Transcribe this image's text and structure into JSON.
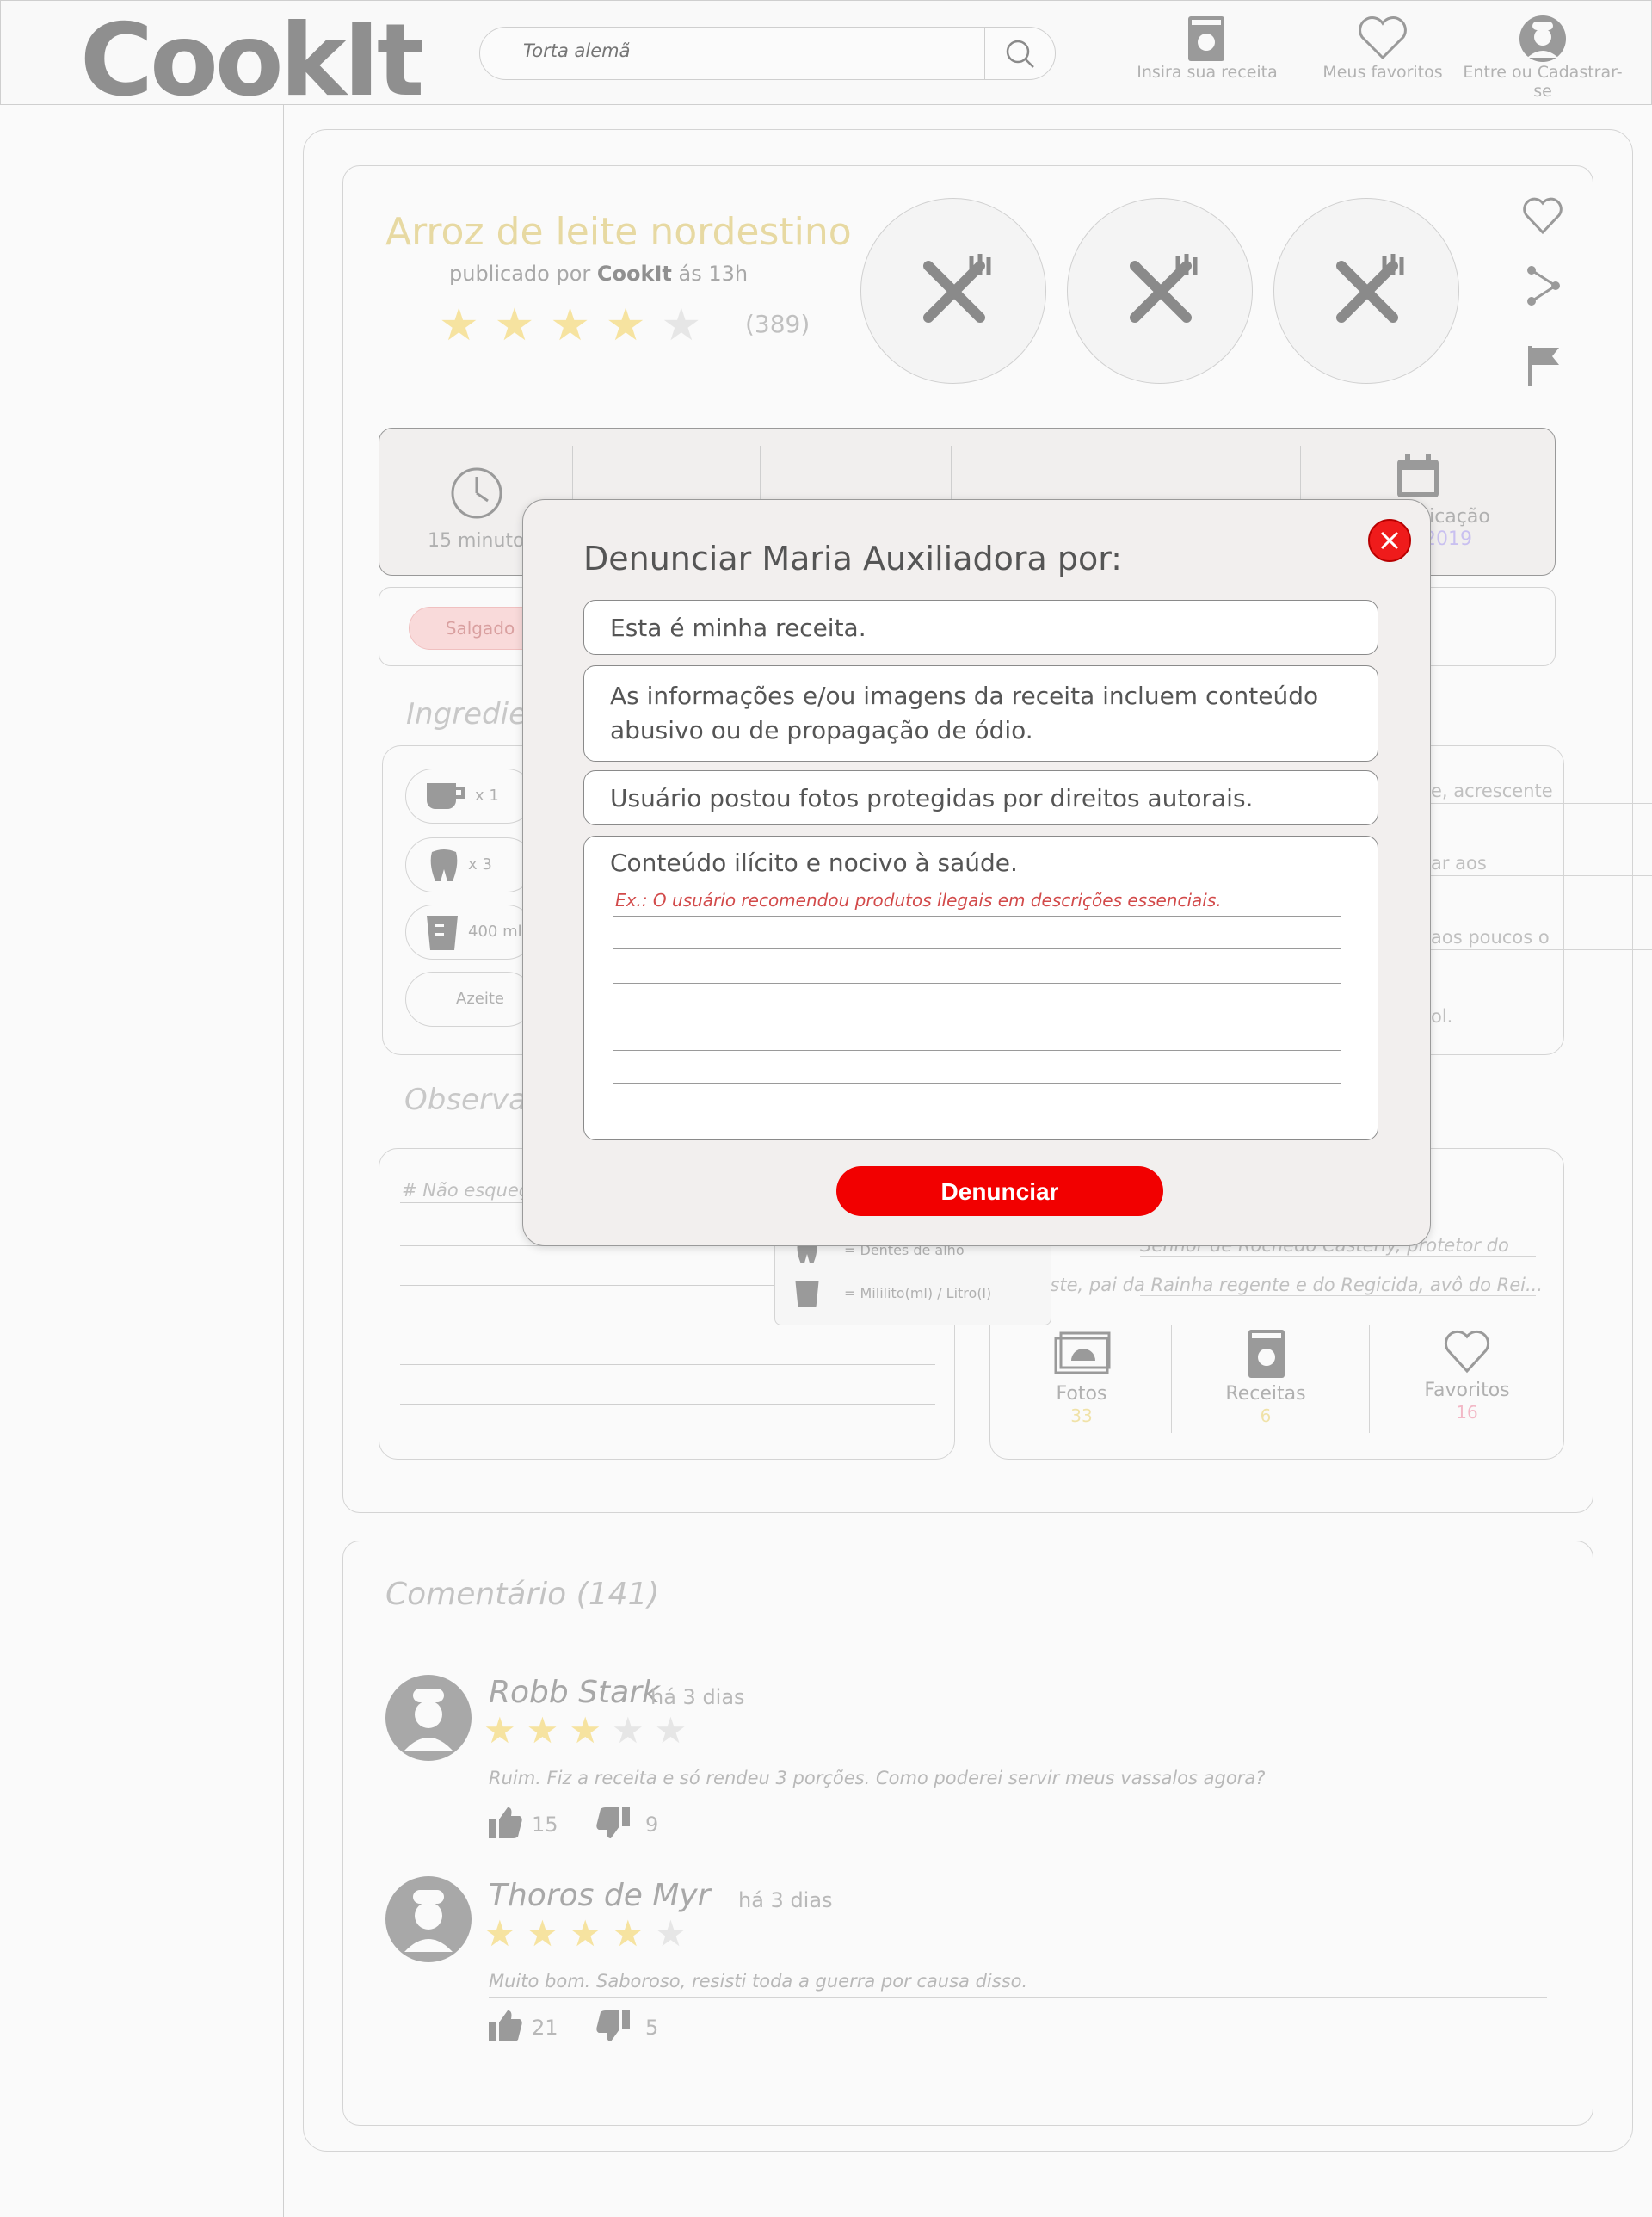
{
  "header": {
    "logo": "CookIt",
    "search_placeholder": "Torta alemã",
    "nav": [
      {
        "label": "Insira sua receita",
        "icon": "recipe-book-icon"
      },
      {
        "label": "Meus favoritos",
        "icon": "heart-icon"
      },
      {
        "label": "Entre ou Cadastrar-se",
        "icon": "chef-avatar-icon"
      }
    ]
  },
  "recipe": {
    "title": "Arroz de leite nordestino",
    "published_prefix": "publicado por",
    "author": "CookIt",
    "published_suffix": "ás 13h",
    "rating": 4,
    "rating_count": "(389)",
    "info": {
      "time": "15 minutos",
      "publish_label": "blicação",
      "publish_date": "2019"
    },
    "tag": "Salgado",
    "ingredients_heading": "Ingredier",
    "ingredients": [
      {
        "qty": "x 1",
        "icon": "cup-icon"
      },
      {
        "qty": "x 3",
        "icon": "garlic-tooth-icon"
      },
      {
        "qty": "400 ml",
        "icon": "measuring-cup-icon"
      },
      {
        "qty": "Azeite",
        "icon": ""
      }
    ],
    "prep_fragments": [
      "e, acrescente",
      "ar aos",
      "aos poucos o",
      "ol."
    ],
    "observations_heading": "Observaç",
    "observation_placeholder": "# Não esqueç",
    "legend": [
      "= Dentes de alho",
      "= Mililito(ml) / Litro(l)"
    ],
    "author_bio": [
      "Senhor de Rochedo Casterly, protetor do",
      "Oeste, pai da Rainha regente e do Regicida, avô do Rei..."
    ],
    "stats": [
      {
        "label": "Fotos",
        "value": "33",
        "color": "#f0e2a8"
      },
      {
        "label": "Receitas",
        "value": "6",
        "color": "#f0e2a8"
      },
      {
        "label": "Favoritos",
        "value": "16",
        "color": "#f2b8c6"
      }
    ]
  },
  "comments": {
    "title": "Comentário (141)",
    "items": [
      {
        "name": "Robb Stark",
        "time": "há 3 dias",
        "rating": 3,
        "text": "Ruim. Fiz a receita e só rendeu 3 porções. Como poderei servir meus vassalos agora?",
        "likes": "15",
        "dislikes": "9"
      },
      {
        "name": "Thoros de Myr",
        "time": "há 3 dias",
        "rating": 4,
        "text": "Muito bom. Saboroso, resisti toda a guerra por causa disso.",
        "likes": "21",
        "dislikes": "5"
      }
    ]
  },
  "modal": {
    "title": "Denunciar Maria Auxiliadora por:",
    "options": [
      "Esta é minha receita.",
      "As informações e/ou imagens da receita incluem conteúdo abusivo ou de propagação de ódio.",
      "Usuário postou fotos protegidas por direitos autorais.",
      "Conteúdo ilícito e nocivo à saúde."
    ],
    "example": "Ex.: O usuário recomendou produtos ilegais em descrições essenciais.",
    "submit_label": "Denunciar"
  },
  "colors": {
    "accent_red": "#f20000",
    "title_yellow": "#e7d9a2",
    "star_yellow": "#f6e3a0"
  }
}
